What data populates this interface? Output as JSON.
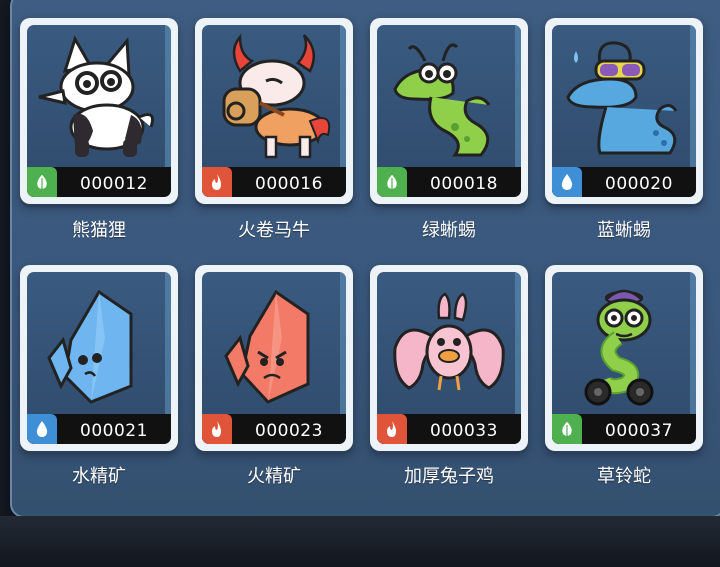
{
  "colors": {
    "panel": "#3a587d",
    "card_frame": "#eef3f8",
    "grass": "#4fb04f",
    "fire": "#e0553a",
    "water": "#3f8fd6"
  },
  "cards": [
    {
      "id": "000012",
      "name": "熊猫狸",
      "element": "grass",
      "element_icon": "leaf-icon",
      "creature_icon": "panda-fox-icon"
    },
    {
      "id": "000016",
      "name": "火卷马牛",
      "element": "fire",
      "element_icon": "flame-icon",
      "creature_icon": "fire-bull-icon"
    },
    {
      "id": "000018",
      "name": "绿蜥蜴",
      "element": "grass",
      "element_icon": "leaf-icon",
      "creature_icon": "green-lizard-icon"
    },
    {
      "id": "000020",
      "name": "蓝蜥蜴",
      "element": "water",
      "element_icon": "droplet-icon",
      "creature_icon": "blue-lizard-icon"
    },
    {
      "id": "000021",
      "name": "水精矿",
      "element": "water",
      "element_icon": "droplet-icon",
      "creature_icon": "water-crystal-icon"
    },
    {
      "id": "000023",
      "name": "火精矿",
      "element": "fire",
      "element_icon": "flame-icon",
      "creature_icon": "fire-crystal-icon"
    },
    {
      "id": "000033",
      "name": "加厚兔子鸡",
      "element": "fire",
      "element_icon": "flame-icon",
      "creature_icon": "rabbit-chick-icon"
    },
    {
      "id": "000037",
      "name": "草铃蛇",
      "element": "grass",
      "element_icon": "leaf-icon",
      "creature_icon": "grass-snake-icon"
    }
  ]
}
